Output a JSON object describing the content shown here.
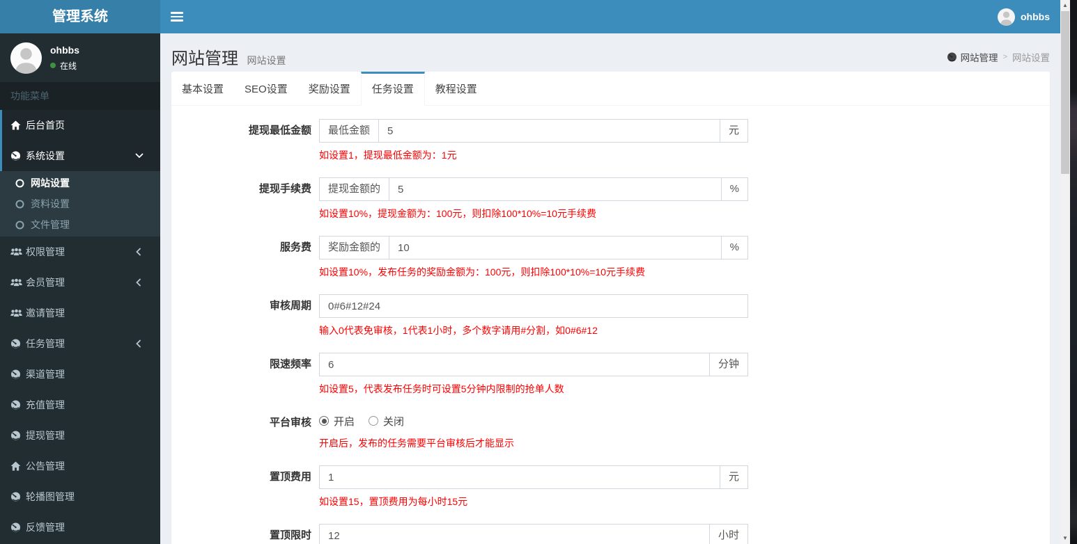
{
  "colors": {
    "accent": "#3c8dbc",
    "brand_bg": "#367fa9",
    "sidebar_bg": "#222d32",
    "submenu_bg": "#2c3b41",
    "hint_red": "#ff0000",
    "online_green": "#3f903f"
  },
  "topbar": {
    "brand": "管理系统",
    "user": {
      "name": "ohbbs"
    }
  },
  "sidebar": {
    "user": {
      "name": "ohbbs",
      "status": "在线"
    },
    "section_label": "功能菜单",
    "items": [
      {
        "label": "后台首页",
        "icon": "home-icon",
        "active": true
      },
      {
        "label": "系统设置",
        "icon": "gauge-icon",
        "chevron": "down",
        "active": true,
        "submenu": [
          {
            "label": "网站设置",
            "icon": "circle-o-icon",
            "active": true
          },
          {
            "label": "资料设置",
            "icon": "circle-o-icon",
            "active": false
          },
          {
            "label": "文件管理",
            "icon": "circle-o-icon",
            "active": false
          }
        ]
      },
      {
        "label": "权限管理",
        "icon": "users-icon",
        "chevron": "left"
      },
      {
        "label": "会员管理",
        "icon": "users-icon",
        "chevron": "left"
      },
      {
        "label": "邀请管理",
        "icon": "users-icon"
      },
      {
        "label": "任务管理",
        "icon": "gauge-icon",
        "chevron": "left"
      },
      {
        "label": "渠道管理",
        "icon": "gauge-icon"
      },
      {
        "label": "充值管理",
        "icon": "gauge-icon"
      },
      {
        "label": "提现管理",
        "icon": "gauge-icon"
      },
      {
        "label": "公告管理",
        "icon": "home-icon"
      },
      {
        "label": "轮播图管理",
        "icon": "gauge-icon"
      },
      {
        "label": "反馈管理",
        "icon": "gauge-icon"
      }
    ]
  },
  "content": {
    "title": "网站管理",
    "subtitle": "网站设置",
    "breadcrumb": {
      "icon": "gauge-icon",
      "items": [
        "网站管理",
        "网站设置"
      ]
    },
    "tabs": [
      {
        "label": "基本设置",
        "active": false
      },
      {
        "label": "SEO设置",
        "active": false
      },
      {
        "label": "奖励设置",
        "active": false
      },
      {
        "label": "任务设置",
        "active": true
      },
      {
        "label": "教程设置",
        "active": false
      }
    ],
    "fields": [
      {
        "label": "提现最低金额",
        "type": "input",
        "prefix": "最低金额",
        "value": "5",
        "suffix": "元",
        "hint": "如设置1，提现最低金额为：1元"
      },
      {
        "label": "提现手续费",
        "type": "input",
        "prefix": "提现金额的",
        "value": "5",
        "suffix": "%",
        "hint": "如设置10%，提现金额为：100元，则扣除100*10%=10元手续费"
      },
      {
        "label": "服务费",
        "type": "input",
        "prefix": "奖励金额的",
        "value": "10",
        "suffix": "%",
        "hint": "如设置10%，发布任务的奖励金额为：100元，则扣除100*10%=10元手续费"
      },
      {
        "label": "审核周期",
        "type": "input",
        "value": "0#6#12#24",
        "hint": "输入0代表免审核，1代表1小时，多个数字请用#分割，如0#6#12"
      },
      {
        "label": "限速频率",
        "type": "input",
        "value": "6",
        "suffix": "分钟",
        "hint": "如设置5，代表发布任务时可设置5分钟内限制的抢单人数"
      },
      {
        "label": "平台审核",
        "type": "radios",
        "options": [
          {
            "label": "开启",
            "checked": true
          },
          {
            "label": "关闭",
            "checked": false
          }
        ],
        "hint": "开启后，发布的任务需要平台审核后才能显示"
      },
      {
        "label": "置顶费用",
        "type": "input",
        "value": "1",
        "suffix": "元",
        "hint": "如设置15，置顶费用为每小时15元"
      },
      {
        "label": "置顶限时",
        "type": "input",
        "value": "12",
        "suffix": "小时",
        "hint": ""
      }
    ]
  }
}
